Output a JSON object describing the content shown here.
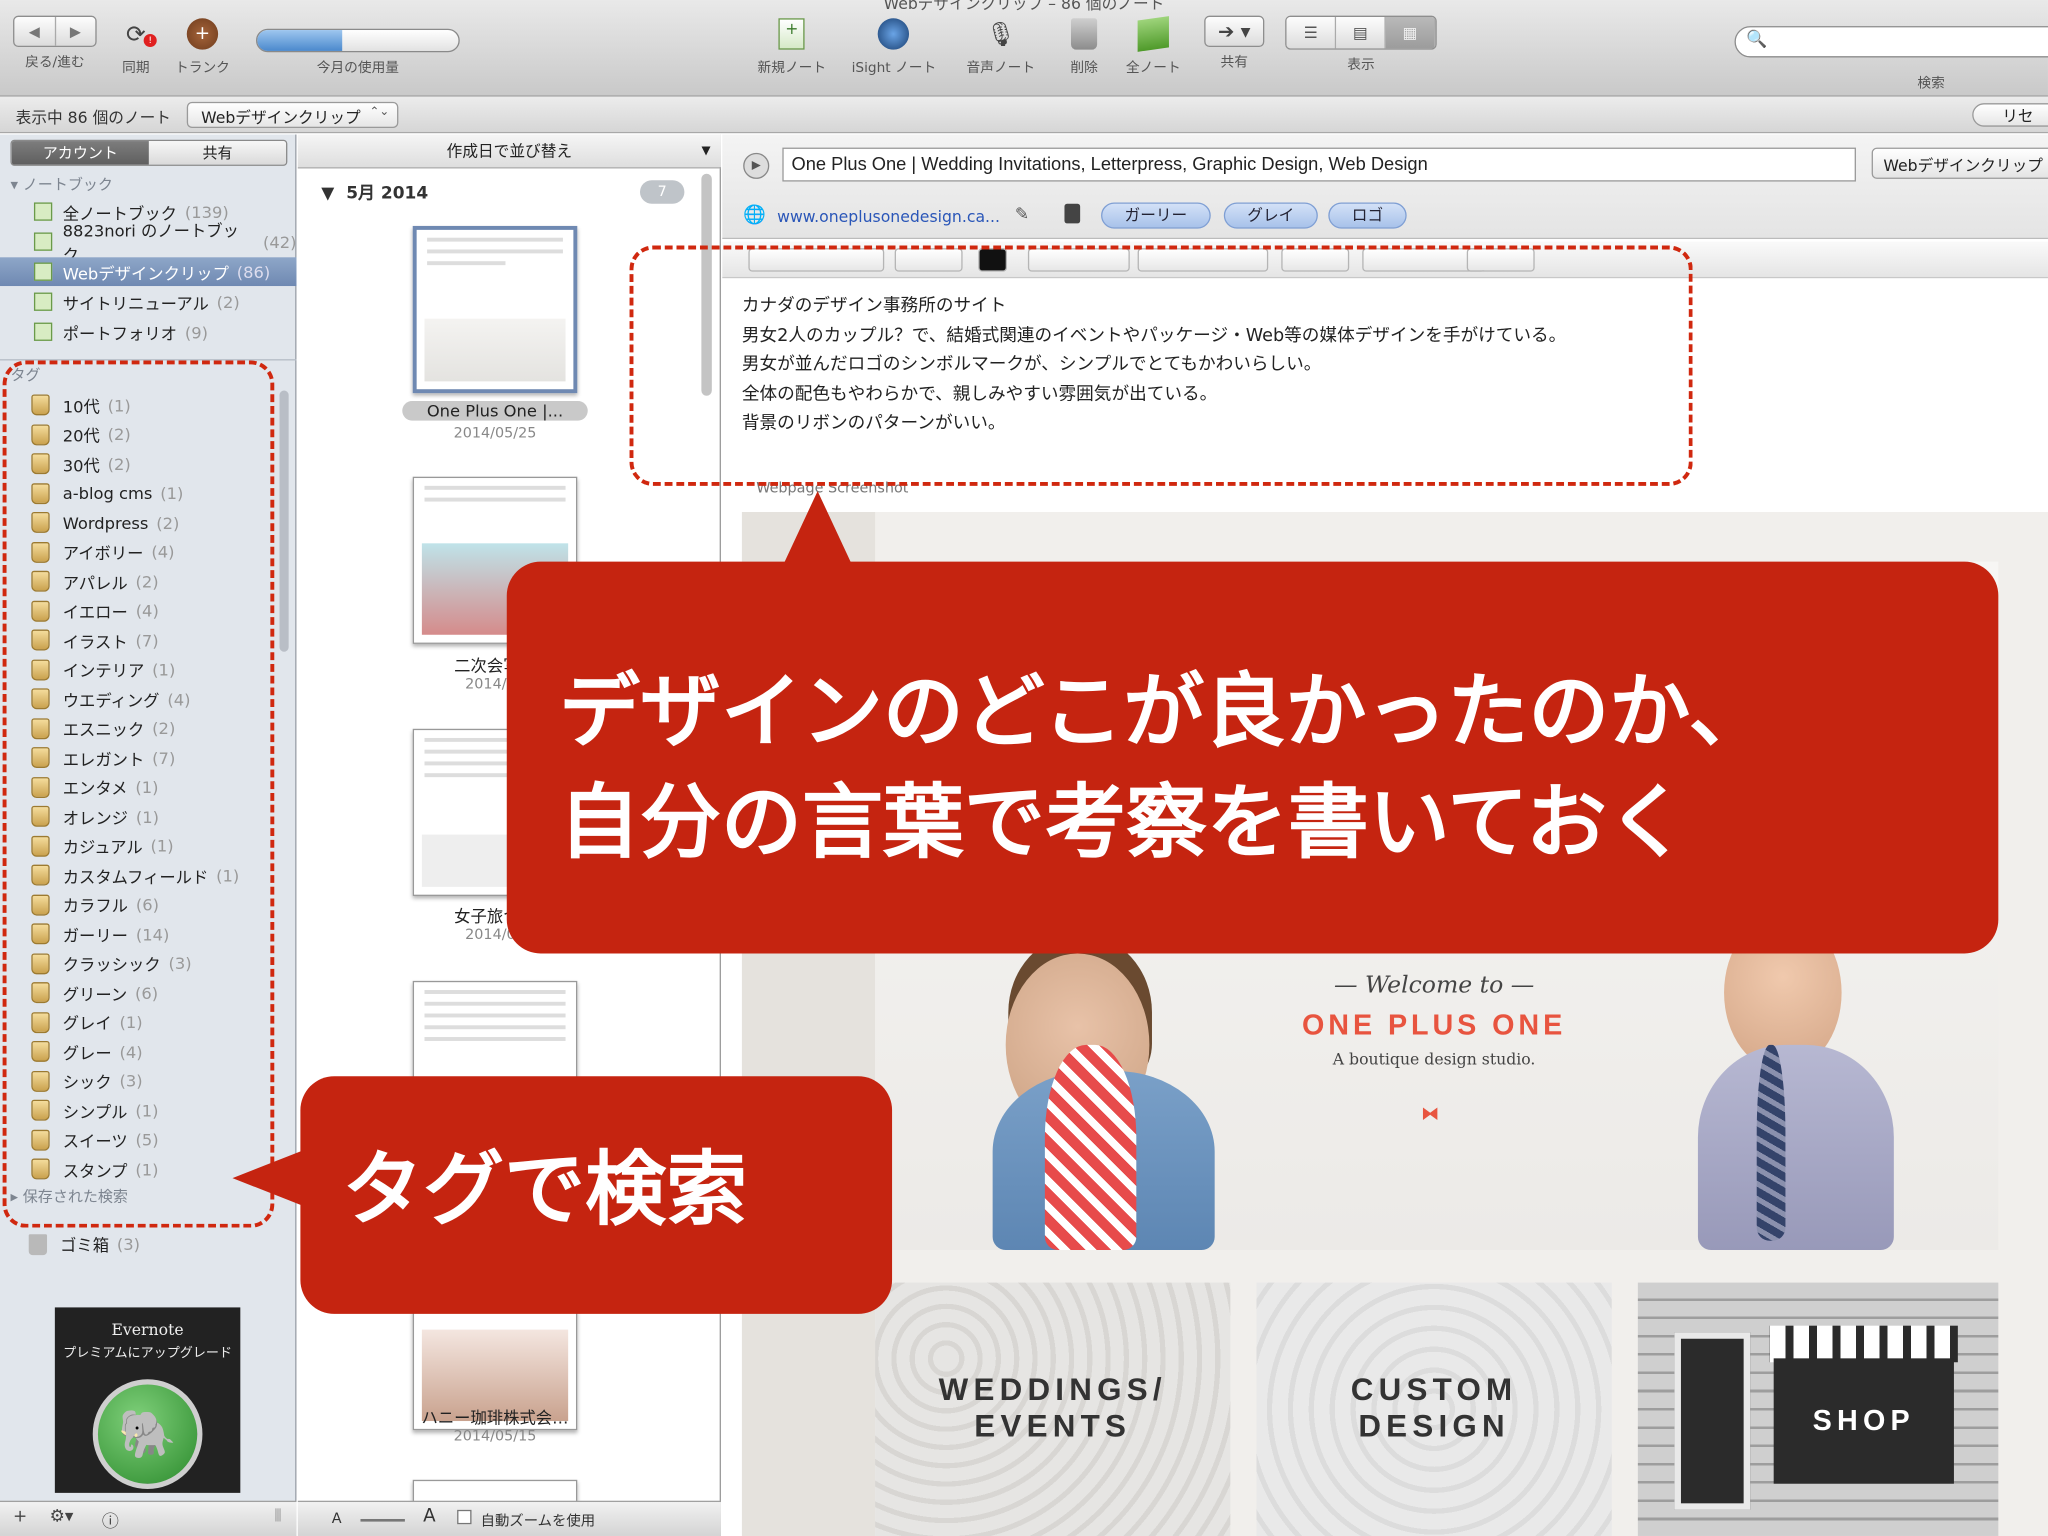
{
  "window": {
    "title": "Webデザインクリップ – 86 個のノート"
  },
  "toolbar": {
    "back_forward": "戻る/進む",
    "sync": "同期",
    "trunk": "トランク",
    "usage_label": "今月の使用量",
    "usage_fraction": 0.42,
    "new_note": "新規ノート",
    "isight_note": "iSight ノート",
    "voice_note": "音声ノート",
    "delete": "削除",
    "all_notes": "全ノート",
    "share": "共有",
    "view": "表示",
    "search": "検索"
  },
  "infobar": {
    "count_text": "表示中 86 個のノート",
    "notebook": "Webデザインクリップ",
    "reset": "リセ"
  },
  "sidebar": {
    "tab_account": "アカウント",
    "tab_shared": "共有",
    "notebooks_header": "ノートブック",
    "notebooks": [
      {
        "label": "全ノートブック",
        "count": "(139)"
      },
      {
        "label": "8823nori のノートブック",
        "count": "(42)"
      },
      {
        "label": "Webデザインクリップ",
        "count": "(86)"
      },
      {
        "label": "サイトリニューアル",
        "count": "(2)"
      },
      {
        "label": "ポートフォリオ",
        "count": "(9)"
      }
    ],
    "tags_header": "タグ",
    "tags": [
      {
        "label": "10代",
        "count": "(1)"
      },
      {
        "label": "20代",
        "count": "(2)"
      },
      {
        "label": "30代",
        "count": "(2)"
      },
      {
        "label": "a-blog cms",
        "count": "(1)"
      },
      {
        "label": "Wordpress",
        "count": "(2)"
      },
      {
        "label": "アイボリー",
        "count": "(4)"
      },
      {
        "label": "アパレル",
        "count": "(2)"
      },
      {
        "label": "イエロー",
        "count": "(4)"
      },
      {
        "label": "イラスト",
        "count": "(7)"
      },
      {
        "label": "インテリア",
        "count": "(1)"
      },
      {
        "label": "ウエディング",
        "count": "(4)"
      },
      {
        "label": "エスニック",
        "count": "(2)"
      },
      {
        "label": "エレガント",
        "count": "(7)"
      },
      {
        "label": "エンタメ",
        "count": "(1)"
      },
      {
        "label": "オレンジ",
        "count": "(1)"
      },
      {
        "label": "カジュアル",
        "count": "(1)"
      },
      {
        "label": "カスタムフィールド",
        "count": "(1)"
      },
      {
        "label": "カラフル",
        "count": "(6)"
      },
      {
        "label": "ガーリー",
        "count": "(14)"
      },
      {
        "label": "クラッシック",
        "count": "(3)"
      },
      {
        "label": "グリーン",
        "count": "(6)"
      },
      {
        "label": "グレイ",
        "count": "(1)"
      },
      {
        "label": "グレー",
        "count": "(4)"
      },
      {
        "label": "シック",
        "count": "(3)"
      },
      {
        "label": "シンプル",
        "count": "(1)"
      },
      {
        "label": "スイーツ",
        "count": "(5)"
      },
      {
        "label": "スタンプ",
        "count": "(1)"
      }
    ],
    "saved_search": "保存された検索",
    "trash": {
      "label": "ゴミ箱",
      "count": "(3)"
    },
    "premium_line1": "Evernote",
    "premium_line2": "プレミアムにアップグレード"
  },
  "notelist": {
    "sort_label": "作成日で並び替え",
    "month": "5月 2014",
    "month_count": "7",
    "notes": [
      {
        "title": "One Plus One |...",
        "date": "2014/05/25"
      },
      {
        "title": "二次会写真",
        "date": "2014/05"
      },
      {
        "title": "女子旅つく",
        "date": "2014/05"
      },
      {
        "title": "",
        "date": ""
      },
      {
        "title": "ハニー珈琲株式会…",
        "date": "2014/05/15"
      }
    ],
    "auto_zoom": "自動ズームを使用"
  },
  "editor": {
    "title": "One Plus One | Wedding Invitations, Letterpress, Graphic Design, Web Design",
    "notebook_btn": "Webデザインクリップ",
    "url": "www.oneplusonedesign.ca...",
    "tags": [
      "ガーリー",
      "グレイ",
      "ロゴ"
    ],
    "body": [
      "カナダのデザイン事務所のサイト",
      "男女2人のカップル？で、結婚式関連のイベントやパッケージ・Web等の媒体デザインを手がけている。",
      "男女が並んだロゴのシンボルマークが、シンプルでとてもかわいらしい。",
      "全体の配色もやわらかで、親しみやすい雰囲気が出ている。",
      "背景のリボンのパターンがいい。"
    ],
    "shot_label": "Webpage Screenshot"
  },
  "website": {
    "welcome": "— Welcome to —",
    "brand": "ONE PLUS ONE",
    "tagline": "A boutique design studio.",
    "tile1_line1": "WEDDINGS/",
    "tile1_line2": "EVENTS",
    "tile2_line1": "CUSTOM",
    "tile2_line2": "DESIGN",
    "tile3": "SHOP"
  },
  "annotations": {
    "callout_main_line1": "デザインのどこが良かったのか、",
    "callout_main_line2": "自分の言葉で考察を書いておく",
    "callout_tag": "タグで検索"
  },
  "colors": {
    "callout": "#c52410",
    "dashed_outline": "#d0280f",
    "selection": "#6f89b2"
  }
}
